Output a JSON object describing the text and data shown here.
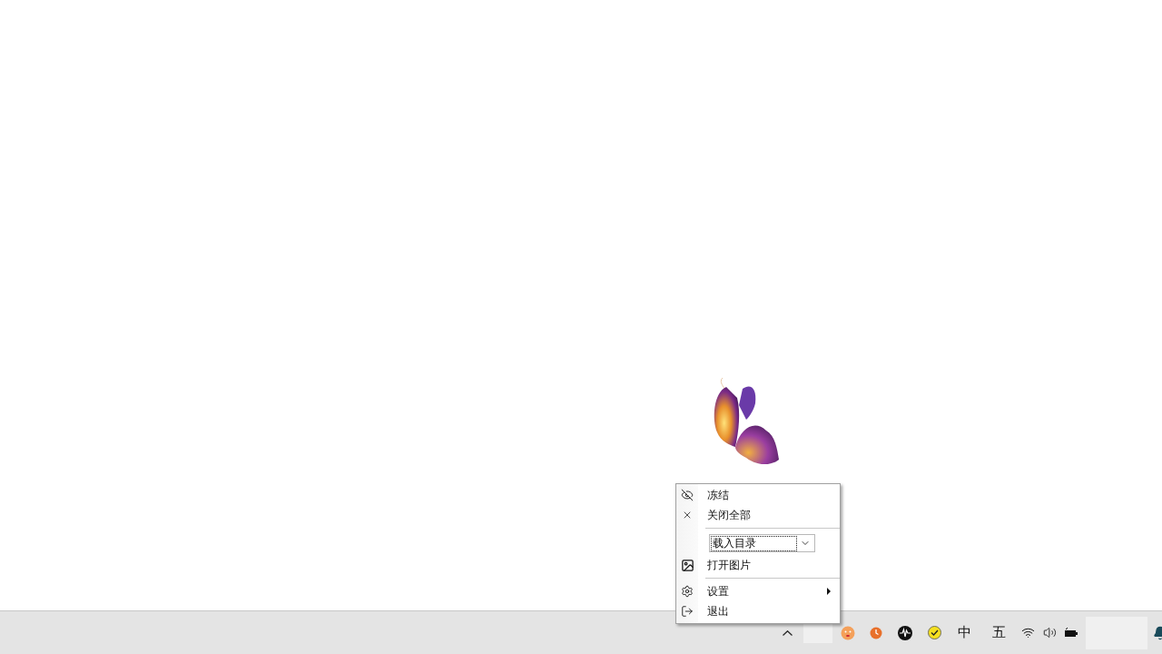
{
  "menu": {
    "items": [
      {
        "kind": "item",
        "label": "冻结"
      },
      {
        "kind": "item",
        "label": "关闭全部"
      },
      {
        "kind": "separator"
      },
      {
        "kind": "combo",
        "value": "载入目录"
      },
      {
        "kind": "item",
        "label": "打开图片"
      },
      {
        "kind": "separator"
      },
      {
        "kind": "submenu",
        "label": "设置"
      },
      {
        "kind": "item",
        "label": "退出"
      }
    ]
  },
  "tray": {
    "ime": [
      {
        "label": "中"
      },
      {
        "label": "五"
      }
    ]
  }
}
